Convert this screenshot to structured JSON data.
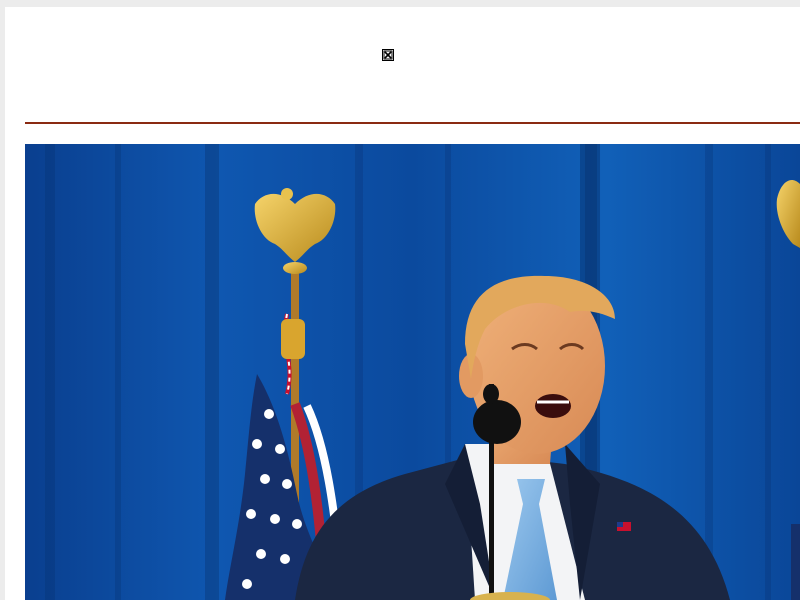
{
  "header": {
    "logo_icon": "broken-image-icon"
  },
  "hero": {
    "image_subject": "photo-speaker-at-podium",
    "colors": {
      "curtain": "#0b4ea2",
      "rule": "#8a2a12"
    }
  }
}
